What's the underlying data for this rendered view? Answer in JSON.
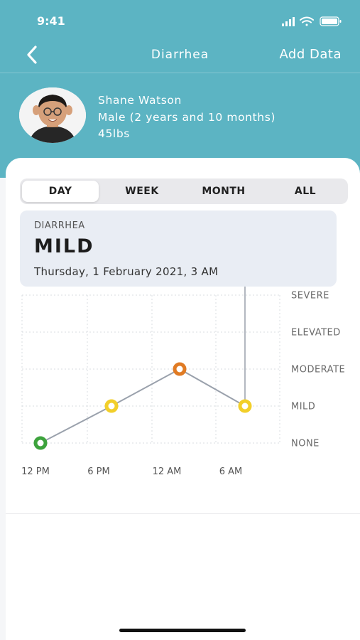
{
  "status_bar": {
    "time": "9:41"
  },
  "nav": {
    "title": "Diarrhea",
    "action": "Add Data"
  },
  "user": {
    "name": "Shane Watson",
    "gender_age": "Male (2 years and 10 months)",
    "weight": "45lbs"
  },
  "tabs": [
    {
      "label": "DAY",
      "active": true
    },
    {
      "label": "WEEK",
      "active": false
    },
    {
      "label": "MONTH",
      "active": false
    },
    {
      "label": "ALL",
      "active": false
    }
  ],
  "tooltip": {
    "label": "DIARRHEA",
    "value": "MILD",
    "date": "Thursday, 1 February 2021, 3 AM"
  },
  "chart_data": {
    "type": "line",
    "y_categories": [
      "NONE",
      "MILD",
      "MODERATE",
      "ELEVATED",
      "SEVERE"
    ],
    "x_tick_labels": [
      "12 PM",
      "6 PM",
      "12 AM",
      "6 AM"
    ],
    "points": [
      {
        "x": "12 PM",
        "y": "NONE",
        "color": "#3da33d"
      },
      {
        "x": "6 PM",
        "y": "MILD",
        "color": "#f2cf2a"
      },
      {
        "x": "12 AM",
        "y": "MODERATE",
        "color": "#e07b24"
      },
      {
        "x": "3 AM",
        "y": "MILD",
        "color": "#f2cf2a"
      }
    ],
    "selected_point": "3 AM",
    "grid": true
  },
  "colors": {
    "header_bg": "#5cb4c3",
    "line": "#9aa1ac"
  }
}
